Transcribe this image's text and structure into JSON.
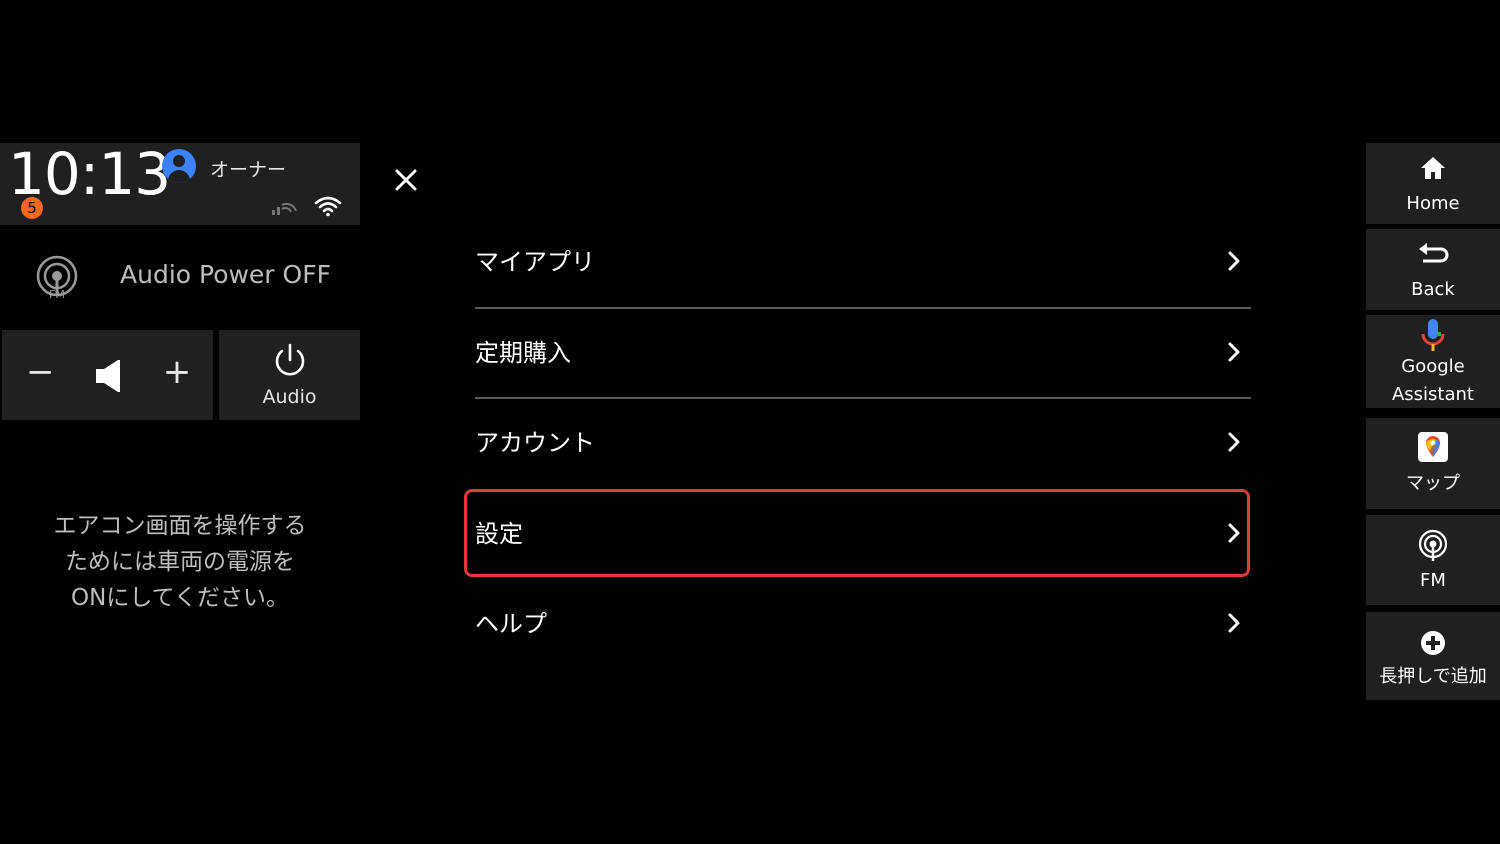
{
  "status": {
    "time": "10:13",
    "user": "オーナー",
    "notification_count": "5"
  },
  "audio": {
    "source_icon": "fm-radio-icon",
    "fm_badge": "FM",
    "status": "Audio Power OFF",
    "minus": "−",
    "plus": "+",
    "power_label": "Audio"
  },
  "ac_notice": {
    "line1": "エアコン画面を操作する",
    "line2": "ためには車両の電源を",
    "line3": "ONにしてください。"
  },
  "menu": {
    "items": [
      {
        "label": "マイアプリ"
      },
      {
        "label": "定期購入"
      },
      {
        "label": "アカウント"
      },
      {
        "label": "設定"
      },
      {
        "label": "ヘルプ"
      }
    ],
    "selected_index": 3
  },
  "dock": {
    "home": "Home",
    "back": "Back",
    "assistant_line1": "Google",
    "assistant_line2": "Assistant",
    "maps": "マップ",
    "fm": "FM",
    "add": "長押しで追加"
  },
  "colors": {
    "background": "#000000",
    "panel": "#202020",
    "highlight": "#e03a3a",
    "badge": "#f36a1f",
    "avatar": "#3b82f6"
  }
}
